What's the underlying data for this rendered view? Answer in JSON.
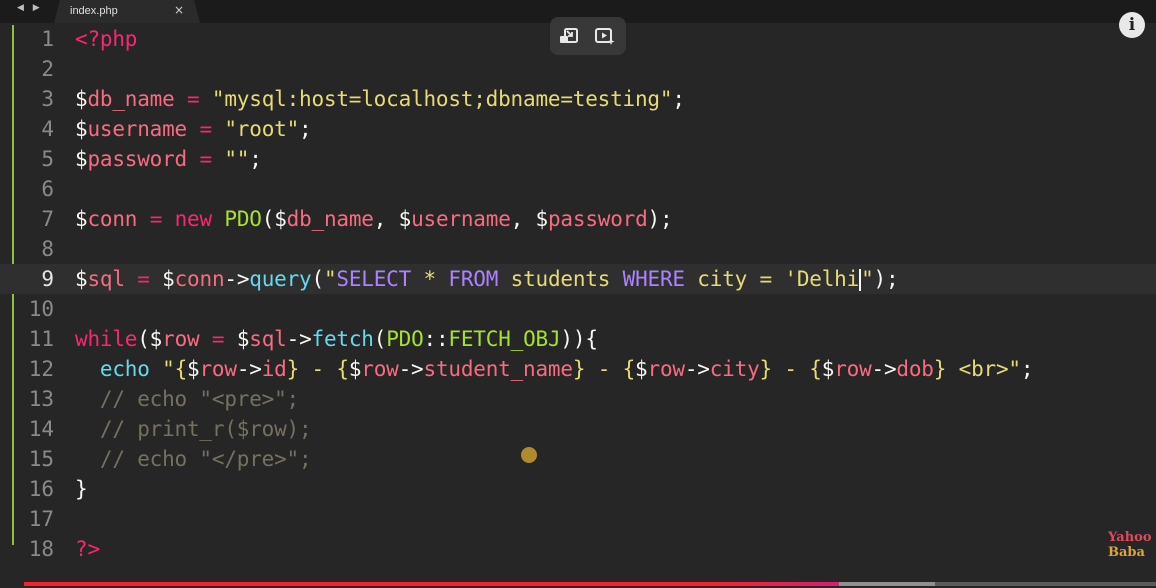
{
  "tab": {
    "nav_arrows": "◀ ▶",
    "title": "index.php",
    "close_glyph": "×"
  },
  "editor": {
    "active_line": 9,
    "git_bar_color": "#8fbf43",
    "lines": [
      {
        "n": "1",
        "tokens": [
          [
            "tag",
            "<?php"
          ]
        ]
      },
      {
        "n": "2",
        "tokens": []
      },
      {
        "n": "3",
        "tokens": [
          [
            "dollar",
            "$"
          ],
          [
            "name",
            "db_name"
          ],
          [
            "plain",
            " "
          ],
          [
            "op",
            "="
          ],
          [
            "plain",
            " "
          ],
          [
            "str",
            "\"mysql:host=localhost;dbname=testing\""
          ],
          [
            "plain",
            ";"
          ]
        ]
      },
      {
        "n": "4",
        "tokens": [
          [
            "dollar",
            "$"
          ],
          [
            "name",
            "username"
          ],
          [
            "plain",
            " "
          ],
          [
            "op",
            "="
          ],
          [
            "plain",
            " "
          ],
          [
            "str",
            "\"root\""
          ],
          [
            "plain",
            ";"
          ]
        ]
      },
      {
        "n": "5",
        "tokens": [
          [
            "dollar",
            "$"
          ],
          [
            "name",
            "password"
          ],
          [
            "plain",
            " "
          ],
          [
            "op",
            "="
          ],
          [
            "plain",
            " "
          ],
          [
            "str",
            "\"\""
          ],
          [
            "plain",
            ";"
          ]
        ]
      },
      {
        "n": "6",
        "tokens": []
      },
      {
        "n": "7",
        "tokens": [
          [
            "dollar",
            "$"
          ],
          [
            "name",
            "conn"
          ],
          [
            "plain",
            " "
          ],
          [
            "op",
            "="
          ],
          [
            "plain",
            " "
          ],
          [
            "kw",
            "new"
          ],
          [
            "plain",
            " "
          ],
          [
            "cls",
            "PDO"
          ],
          [
            "plain",
            "("
          ],
          [
            "dollar",
            "$"
          ],
          [
            "name",
            "db_name"
          ],
          [
            "plain",
            ", "
          ],
          [
            "dollar",
            "$"
          ],
          [
            "name",
            "username"
          ],
          [
            "plain",
            ", "
          ],
          [
            "dollar",
            "$"
          ],
          [
            "name",
            "password"
          ],
          [
            "plain",
            ");"
          ]
        ]
      },
      {
        "n": "8",
        "tokens": []
      },
      {
        "n": "9",
        "tokens": [
          [
            "dollar",
            "$"
          ],
          [
            "name",
            "sql"
          ],
          [
            "plain",
            " "
          ],
          [
            "op",
            "="
          ],
          [
            "plain",
            " "
          ],
          [
            "dollar",
            "$"
          ],
          [
            "name",
            "conn"
          ],
          [
            "plain",
            "->"
          ],
          [
            "fn",
            "query"
          ],
          [
            "plain",
            "("
          ],
          [
            "str",
            "\""
          ],
          [
            "sql",
            "SELECT"
          ],
          [
            "str",
            " * "
          ],
          [
            "sql",
            "FROM"
          ],
          [
            "str",
            " students "
          ],
          [
            "sql",
            "WHERE"
          ],
          [
            "str",
            " city = 'Delhi"
          ],
          [
            "cursor",
            ""
          ],
          [
            "str",
            "\""
          ],
          [
            "plain",
            ");"
          ]
        ]
      },
      {
        "n": "10",
        "tokens": []
      },
      {
        "n": "11",
        "tokens": [
          [
            "kw",
            "while"
          ],
          [
            "plain",
            "("
          ],
          [
            "dollar",
            "$"
          ],
          [
            "name",
            "row"
          ],
          [
            "plain",
            " "
          ],
          [
            "op",
            "="
          ],
          [
            "plain",
            " "
          ],
          [
            "dollar",
            "$"
          ],
          [
            "name",
            "sql"
          ],
          [
            "plain",
            "->"
          ],
          [
            "fn",
            "fetch"
          ],
          [
            "plain",
            "("
          ],
          [
            "cls",
            "PDO"
          ],
          [
            "plain",
            "::"
          ],
          [
            "cls",
            "FETCH_OBJ"
          ],
          [
            "plain",
            "))"
          ],
          [
            "plain",
            "{"
          ]
        ]
      },
      {
        "n": "12",
        "tokens": [
          [
            "plain",
            "  "
          ],
          [
            "fn",
            "echo"
          ],
          [
            "plain",
            " "
          ],
          [
            "str",
            "\"{"
          ],
          [
            "dollar",
            "$"
          ],
          [
            "name",
            "row"
          ],
          [
            "plain",
            "->"
          ],
          [
            "name",
            "id"
          ],
          [
            "str",
            "} - {"
          ],
          [
            "dollar",
            "$"
          ],
          [
            "name",
            "row"
          ],
          [
            "plain",
            "->"
          ],
          [
            "name",
            "student_name"
          ],
          [
            "str",
            "} - {"
          ],
          [
            "dollar",
            "$"
          ],
          [
            "name",
            "row"
          ],
          [
            "plain",
            "->"
          ],
          [
            "name",
            "city"
          ],
          [
            "str",
            "} - {"
          ],
          [
            "dollar",
            "$"
          ],
          [
            "name",
            "row"
          ],
          [
            "plain",
            "->"
          ],
          [
            "name",
            "dob"
          ],
          [
            "str",
            "} <br>\""
          ],
          [
            "plain",
            ";"
          ]
        ]
      },
      {
        "n": "13",
        "tokens": [
          [
            "cmt",
            "  // echo \"<pre>\";"
          ]
        ]
      },
      {
        "n": "14",
        "tokens": [
          [
            "cmt",
            "  // print_r($row);"
          ]
        ]
      },
      {
        "n": "15",
        "tokens": [
          [
            "cmt",
            "  // echo \"</pre>\";"
          ]
        ]
      },
      {
        "n": "16",
        "tokens": [
          [
            "plain",
            "}"
          ]
        ]
      },
      {
        "n": "17",
        "tokens": []
      },
      {
        "n": "18",
        "tokens": [
          [
            "tag",
            "?>"
          ]
        ]
      }
    ]
  },
  "overlay": {
    "miniplayer_icon": "miniplayer-icon",
    "autoplay_icon": "autoplay-icon",
    "info_glyph": "i"
  },
  "watermark": {
    "line1": "Yahoo",
    "line2": "Baba"
  },
  "progress": {
    "played_fraction": 0.72,
    "buffered_fraction": 0.805,
    "played_color": "#ff1e2d",
    "track_color": "#5a5a5a"
  }
}
